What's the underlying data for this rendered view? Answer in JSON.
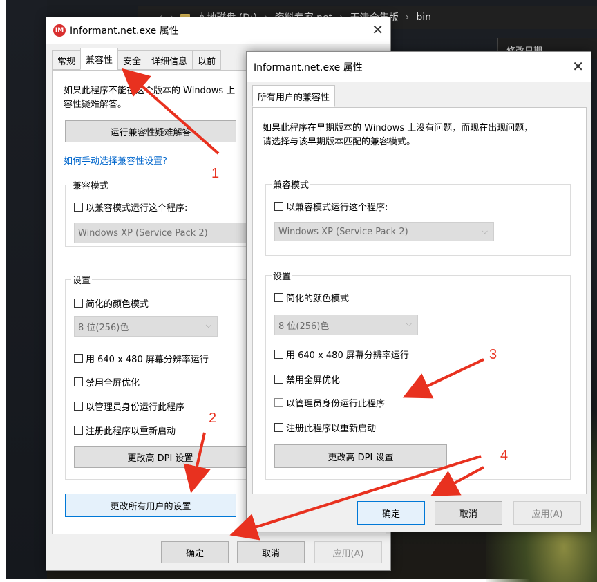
{
  "explorer": {
    "path": [
      "本地磁盘 (D:)",
      "资料专家.net",
      "天津全集版",
      "bin"
    ],
    "column_header": "修改日期"
  },
  "dialog1": {
    "title": "Informant.net.exe 属性",
    "tabs": [
      "常规",
      "兼容性",
      "安全",
      "详细信息",
      "以前"
    ],
    "intro_line1": "如果此程序不能在这个版本的 Windows 上",
    "intro_line2": "容性疑难解答。",
    "troubleshoot_button": "运行兼容性疑难解答",
    "manual_link": "如何手动选择兼容性设置?",
    "compat_group_title": "兼容模式",
    "compat_checkbox": "以兼容模式运行这个程序:",
    "compat_select": "Windows XP (Service Pack 2)",
    "settings_group_title": "设置",
    "reduced_color": "简化的颜色模式",
    "color_select": "8 位(256)色",
    "res_640": "用 640 x 480 屏幕分辨率运行",
    "disable_fullscreen": "禁用全屏优化",
    "run_as_admin": "以管理员身份运行此程序",
    "register_restart": "注册此程序以重新启动",
    "dpi_button": "更改高 DPI 设置",
    "all_users_button": "更改所有用户的设置",
    "ok": "确定",
    "cancel": "取消",
    "apply": "应用(A)"
  },
  "dialog2": {
    "title": "Informant.net.exe 属性",
    "tab": "所有用户的兼容性",
    "intro_line1": "如果此程序在早期版本的 Windows 上没有问题，而现在出现问题，",
    "intro_line2": "请选择与该早期版本匹配的兼容模式。",
    "compat_group_title": "兼容模式",
    "compat_checkbox": "以兼容模式运行这个程序:",
    "compat_select": "Windows XP (Service Pack 2)",
    "settings_group_title": "设置",
    "reduced_color": "简化的颜色模式",
    "color_select": "8 位(256)色",
    "res_640": "用 640 x 480 屏幕分辨率运行",
    "disable_fullscreen": "禁用全屏优化",
    "run_as_admin": "以管理员身份运行此程序",
    "register_restart": "注册此程序以重新启动",
    "dpi_button": "更改高 DPI 设置",
    "ok": "确定",
    "cancel": "取消",
    "apply": "应用(A)"
  },
  "annotations": {
    "n1": "1",
    "n2": "2",
    "n3": "3",
    "n4": "4",
    "color": "#e8311f"
  },
  "icons": {
    "app": "IM",
    "close": "✕",
    "chevron": "⌵"
  }
}
